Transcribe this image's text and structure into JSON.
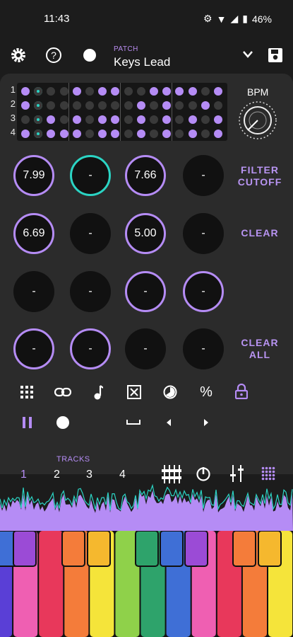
{
  "status": {
    "time": "11:43",
    "battery": "46%"
  },
  "header": {
    "patch_label": "PATCH",
    "patch_name": "Keys Lead",
    "icons": [
      "gear-icon",
      "help-icon",
      "record-dot-icon",
      "chevron-down-icon",
      "save-icon"
    ]
  },
  "sequencer": {
    "rows": [
      "1",
      "2",
      "3",
      "4"
    ],
    "bpm_label": "BPM",
    "pattern": [
      [
        1,
        2,
        0,
        0,
        1,
        0,
        1,
        1,
        0,
        0,
        1,
        1,
        1,
        1,
        0,
        1
      ],
      [
        1,
        2,
        0,
        0,
        0,
        0,
        0,
        0,
        0,
        1,
        0,
        1,
        0,
        0,
        1,
        0
      ],
      [
        0,
        2,
        1,
        0,
        1,
        0,
        1,
        1,
        0,
        1,
        0,
        1,
        0,
        1,
        0,
        1
      ],
      [
        1,
        2,
        1,
        1,
        1,
        0,
        1,
        1,
        0,
        1,
        0,
        1,
        0,
        1,
        0,
        1
      ]
    ]
  },
  "knobs": [
    [
      {
        "value": "7.99",
        "style": "ring"
      },
      {
        "value": "-",
        "style": "teal"
      },
      {
        "value": "7.66",
        "style": "ring"
      },
      {
        "value": "-",
        "style": "plain"
      }
    ],
    [
      {
        "value": "6.69",
        "style": "ring"
      },
      {
        "value": "-",
        "style": "plain"
      },
      {
        "value": "5.00",
        "style": "ring"
      },
      {
        "value": "-",
        "style": "plain"
      }
    ],
    [
      {
        "value": "-",
        "style": "plain"
      },
      {
        "value": "-",
        "style": "plain"
      },
      {
        "value": "-",
        "style": "ring"
      },
      {
        "value": "-",
        "style": "ring"
      }
    ],
    [
      {
        "value": "-",
        "style": "ring"
      },
      {
        "value": "-",
        "style": "ring"
      },
      {
        "value": "-",
        "style": "plain"
      },
      {
        "value": "-",
        "style": "plain"
      }
    ]
  ],
  "side_buttons": {
    "filter_cutoff": [
      "FILTER",
      "CUTOFF"
    ],
    "clear": "CLEAR",
    "clear_all": [
      "CLEAR",
      "ALL"
    ]
  },
  "tools": [
    "grid-icon",
    "link-icon",
    "note-icon",
    "box-x-icon",
    "contrast-icon",
    "percent-icon",
    "lock-icon"
  ],
  "transport": [
    "pause-icon",
    "record-icon",
    "space-icon",
    "left-icon",
    "right-icon"
  ],
  "tracks": {
    "label": "TRACKS",
    "items": [
      "1",
      "2",
      "3",
      "4"
    ],
    "active": "1"
  },
  "track_tools": [
    "mixer-icon",
    "dial-icon",
    "eq-icon",
    "dots-grid-icon"
  ],
  "colors": {
    "accent": "#b58cf5",
    "teal": "#2bd4c4",
    "keys": [
      "#5a3fd6",
      "#ef5fb2",
      "#e8385b",
      "#f47c3a",
      "#f5b82e",
      "#f5e43a",
      "#8fd14a",
      "#2ea36b",
      "#3f6fd6",
      "#9b4bd6"
    ]
  }
}
